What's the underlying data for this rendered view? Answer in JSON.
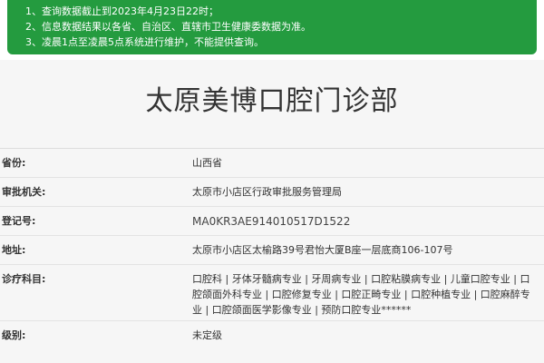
{
  "notice": {
    "lines": [
      "1、查询数据截止到2023年4月23日22时；",
      "2、信息数据结果以各省、自治区、直辖市卫生健康委数据为准。",
      "3、凌晨1点至凌晨5点系统进行维护，不能提供查询。"
    ]
  },
  "clinic": {
    "name": "太原美博口腔门诊部"
  },
  "fields": {
    "province": {
      "label": "省份:",
      "value": "山西省"
    },
    "authority": {
      "label": "审批机关:",
      "value": "太原市小店区行政审批服务管理局"
    },
    "registration": {
      "label": "登记号:",
      "value": "MA0KR3AE914010517D1522"
    },
    "address": {
      "label": "地址:",
      "value": "太原市小店区太榆路39号君怡大厦B座一层底商106-107号"
    },
    "scope": {
      "label": "诊疗科目:",
      "value": "口腔科 | 牙体牙髓病专业 | 牙周病专业 | 口腔粘膜病专业 | 儿童口腔专业 | 口腔颌面外科专业 | 口腔修复专业 | 口腔正畸专业 | 口腔种植专业 | 口腔麻醉专业 | 口腔颌面医学影像专业 | 预防口腔专业******"
    },
    "level": {
      "label": "级别:",
      "value": "未定级"
    }
  }
}
